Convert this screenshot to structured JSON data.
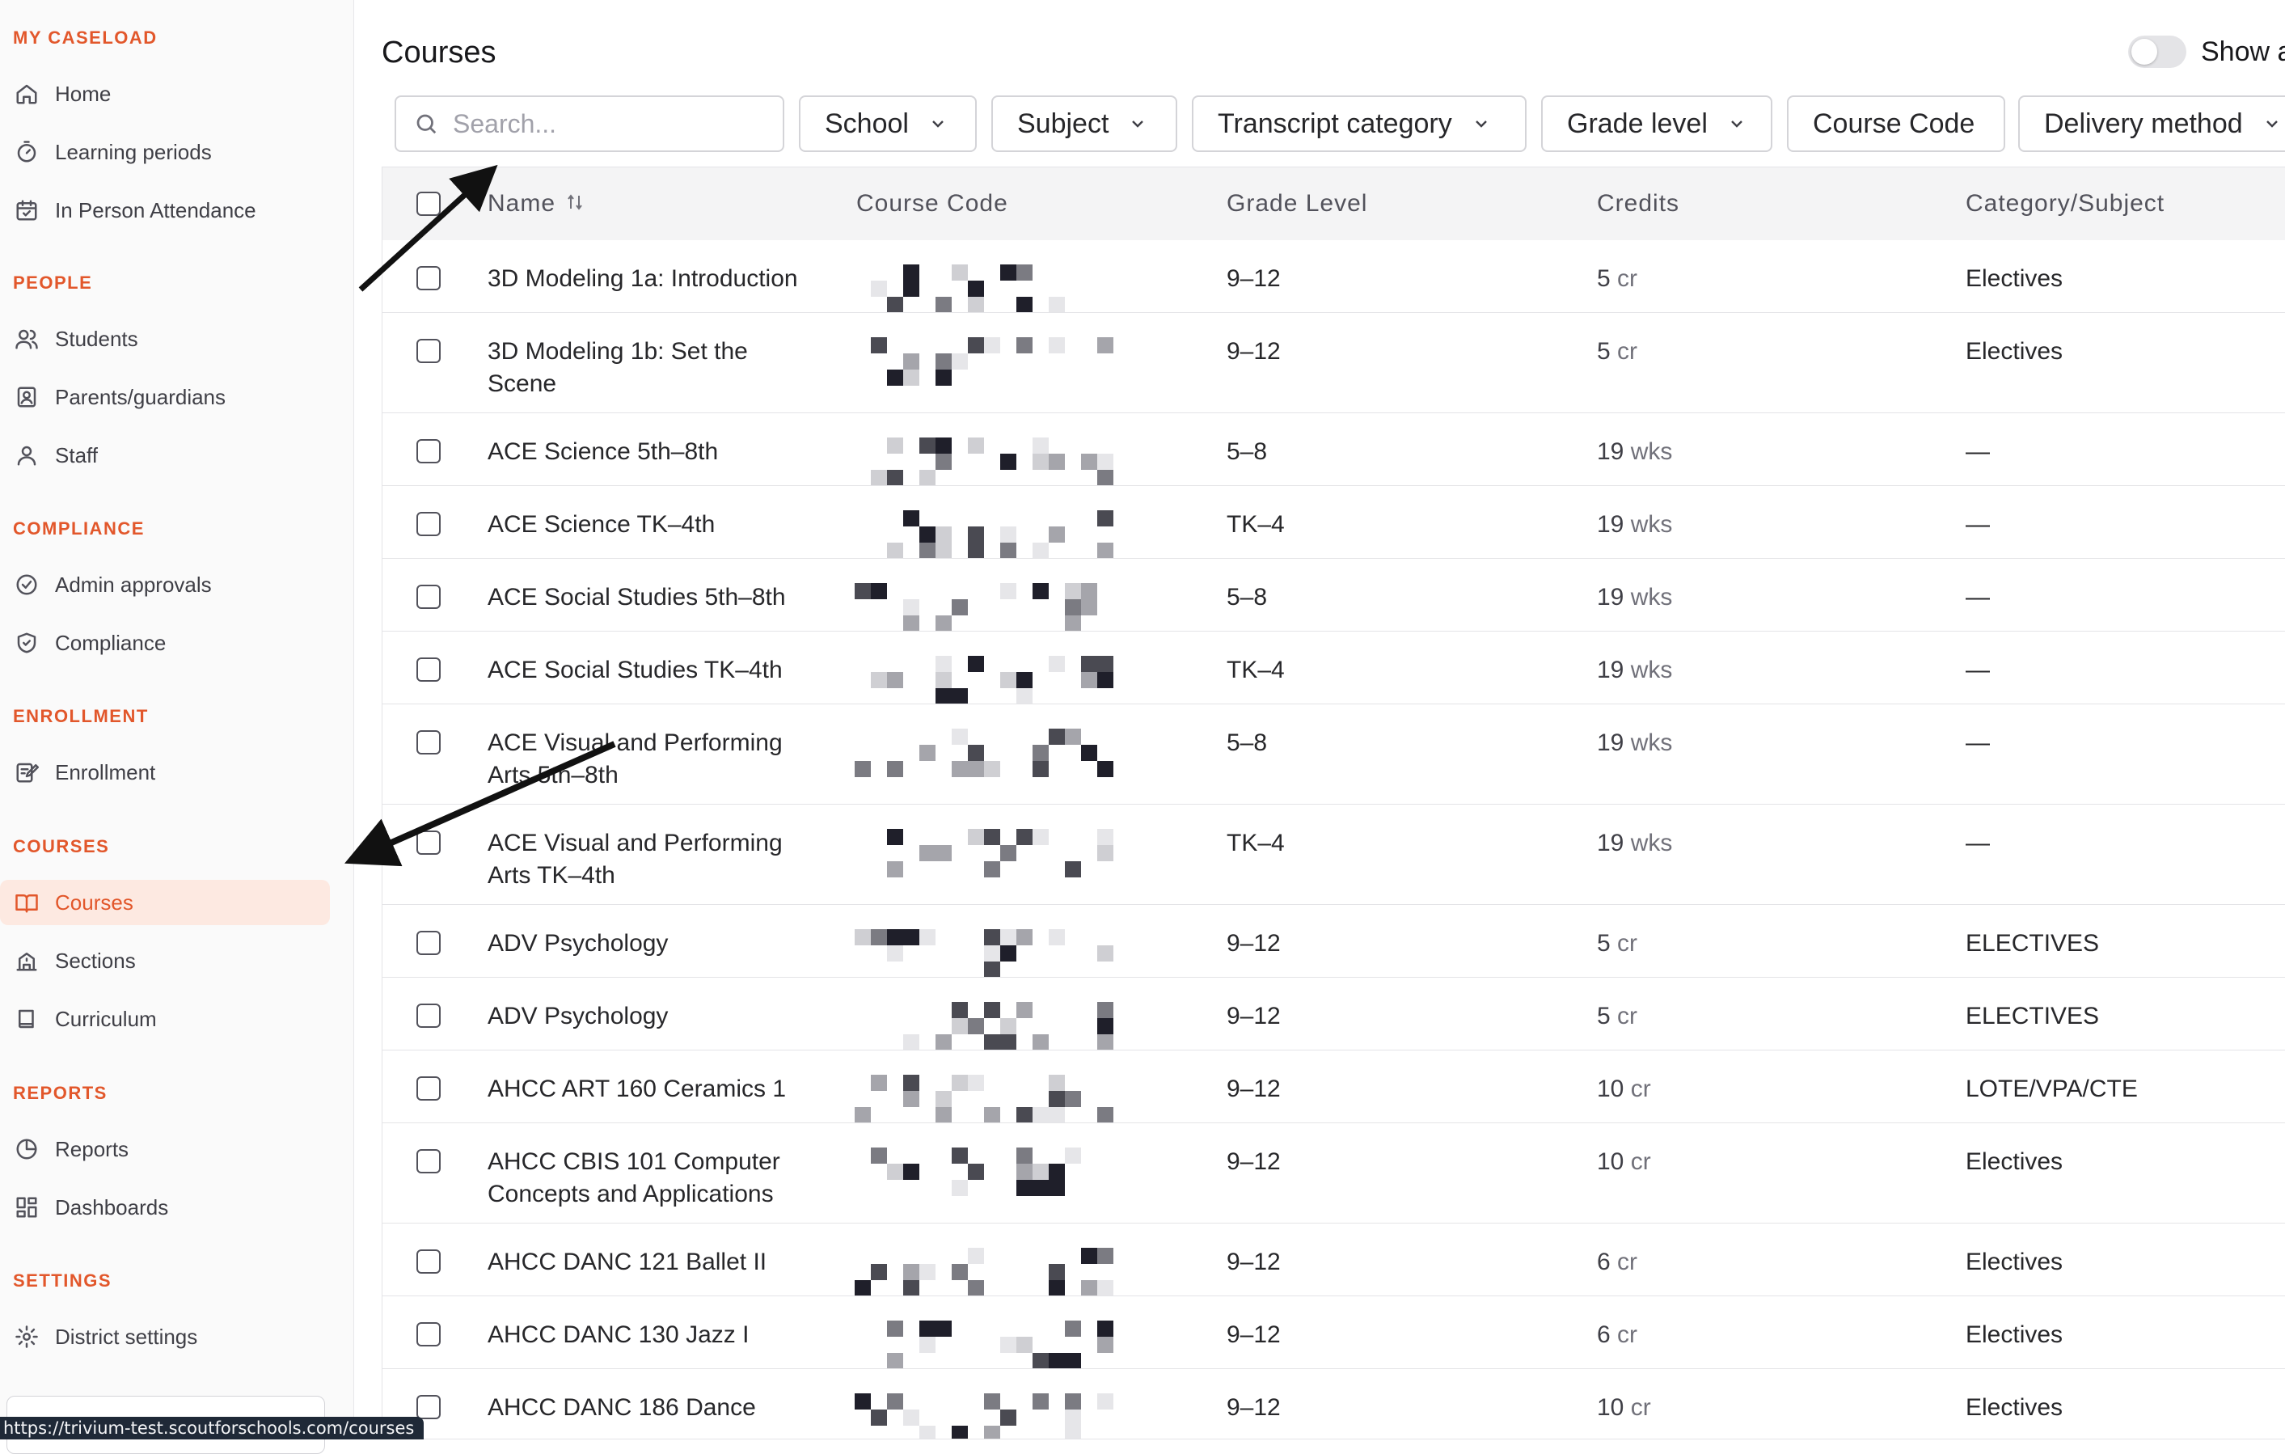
{
  "sidebar": {
    "sections": [
      {
        "title": "MY CASELOAD",
        "items": [
          {
            "label": "Home",
            "icon": "home-icon"
          },
          {
            "label": "Learning periods",
            "icon": "timer-icon"
          },
          {
            "label": "In Person Attendance",
            "icon": "calendar-check-icon"
          }
        ]
      },
      {
        "title": "PEOPLE",
        "items": [
          {
            "label": "Students",
            "icon": "users-icon"
          },
          {
            "label": "Parents/guardians",
            "icon": "contact-icon"
          },
          {
            "label": "Staff",
            "icon": "user-icon"
          }
        ]
      },
      {
        "title": "COMPLIANCE",
        "items": [
          {
            "label": "Admin approvals",
            "icon": "check-circle-icon"
          },
          {
            "label": "Compliance",
            "icon": "shield-check-icon"
          }
        ]
      },
      {
        "title": "ENROLLMENT",
        "items": [
          {
            "label": "Enrollment",
            "icon": "edit-note-icon"
          }
        ]
      },
      {
        "title": "COURSES",
        "items": [
          {
            "label": "Courses",
            "icon": "book-open-icon",
            "active": true
          },
          {
            "label": "Sections",
            "icon": "school-icon"
          },
          {
            "label": "Curriculum",
            "icon": "book-icon"
          }
        ]
      },
      {
        "title": "REPORTS",
        "items": [
          {
            "label": "Reports",
            "icon": "pie-chart-icon"
          },
          {
            "label": "Dashboards",
            "icon": "dashboard-icon"
          }
        ]
      },
      {
        "title": "SETTINGS",
        "items": [
          {
            "label": "District settings",
            "icon": "gear-icon"
          }
        ]
      }
    ]
  },
  "status_url": "https://trivium-test.scoutforschools.com/courses",
  "header": {
    "title": "Courses",
    "toggle_label": "Show a"
  },
  "search": {
    "placeholder": "Search..."
  },
  "filters": [
    "School",
    "Subject",
    "Transcript category",
    "Grade level",
    "Course Code",
    "Delivery method"
  ],
  "table": {
    "columns": [
      "Name",
      "Course Code",
      "Grade Level",
      "Credits",
      "Category/Subject"
    ],
    "rows": [
      {
        "name": "3D Modeling 1a: Introduction",
        "grade": "9–12",
        "credits_num": "5",
        "credits_unit": "cr",
        "category": "Electives"
      },
      {
        "name": "3D Modeling 1b: Set the Scene",
        "grade": "9–12",
        "credits_num": "5",
        "credits_unit": "cr",
        "category": "Electives"
      },
      {
        "name": "ACE Science 5th–8th",
        "grade": "5–8",
        "credits_num": "19",
        "credits_unit": "wks",
        "category": "—"
      },
      {
        "name": "ACE Science TK–4th",
        "grade": "TK–4",
        "credits_num": "19",
        "credits_unit": "wks",
        "category": "—"
      },
      {
        "name": "ACE Social Studies 5th–8th",
        "grade": "5–8",
        "credits_num": "19",
        "credits_unit": "wks",
        "category": "—"
      },
      {
        "name": "ACE Social Studies TK–4th",
        "grade": "TK–4",
        "credits_num": "19",
        "credits_unit": "wks",
        "category": "—"
      },
      {
        "name": "ACE Visual and Performing Arts 5th–8th",
        "grade": "5–8",
        "credits_num": "19",
        "credits_unit": "wks",
        "category": "—"
      },
      {
        "name": "ACE Visual and Performing Arts TK–4th",
        "grade": "TK–4",
        "credits_num": "19",
        "credits_unit": "wks",
        "category": "—"
      },
      {
        "name": "ADV Psychology",
        "grade": "9–12",
        "credits_num": "5",
        "credits_unit": "cr",
        "category": "ELECTIVES"
      },
      {
        "name": "ADV Psychology",
        "grade": "9–12",
        "credits_num": "5",
        "credits_unit": "cr",
        "category": "ELECTIVES"
      },
      {
        "name": "AHCC ART 160 Ceramics 1",
        "grade": "9–12",
        "credits_num": "10",
        "credits_unit": "cr",
        "category": "LOTE/VPA/CTE"
      },
      {
        "name": "AHCC CBIS 101 Computer Concepts and Applications",
        "grade": "9–12",
        "credits_num": "10",
        "credits_unit": "cr",
        "category": "Electives"
      },
      {
        "name": "AHCC DANC 121 Ballet II",
        "grade": "9–12",
        "credits_num": "6",
        "credits_unit": "cr",
        "category": "Electives"
      },
      {
        "name": "AHCC DANC 130 Jazz I",
        "grade": "9–12",
        "credits_num": "6",
        "credits_unit": "cr",
        "category": "Electives"
      },
      {
        "name": "AHCC DANC 186 Dance",
        "grade": "9–12",
        "credits_num": "10",
        "credits_unit": "cr",
        "category": "Electives"
      }
    ]
  },
  "colors": {
    "accent": "#e2572b",
    "active_bg": "#fde9e1"
  }
}
